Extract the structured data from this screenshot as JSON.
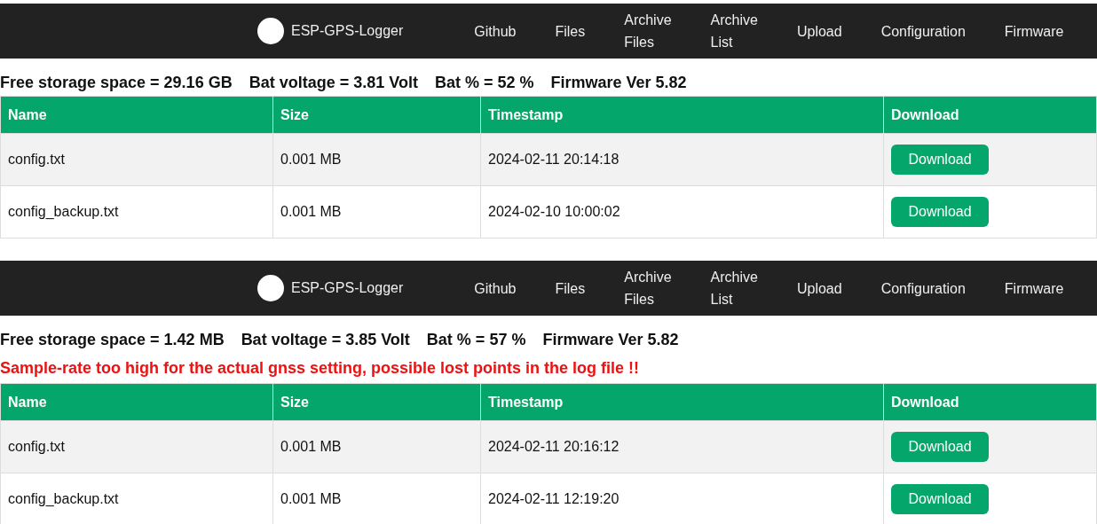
{
  "panels": [
    {
      "nav": {
        "brand": "ESP-GPS-Logger",
        "links": [
          "Github",
          "Files",
          "Archive Files",
          "Archive List",
          "Upload",
          "Configuration",
          "Firmware"
        ]
      },
      "status": [
        "Free storage space = 29.16 GB",
        "Bat voltage = 3.81 Volt",
        "Bat % = 52 %",
        "Firmware Ver 5.82"
      ],
      "table": {
        "columns": [
          "Name",
          "Size",
          "Timestamp",
          "Download"
        ],
        "rows": [
          {
            "cells": [
              "config.txt",
              "0.001 MB",
              "2024-02-11 20:14:18"
            ],
            "button": "Download"
          },
          {
            "cells": [
              "config_backup.txt",
              "0.001 MB",
              "2024-02-10 10:00:02"
            ],
            "button": "Download"
          }
        ]
      }
    },
    {
      "nav": {
        "brand": "ESP-GPS-Logger",
        "links": [
          "Github",
          "Files",
          "Archive Files",
          "Archive List",
          "Upload",
          "Configuration",
          "Firmware"
        ]
      },
      "status": [
        "Free storage space = 1.42 MB",
        "Bat voltage = 3.85 Volt",
        "Bat % = 57 %",
        "Firmware Ver 5.82"
      ],
      "warning": "Sample-rate too high for the actual gnss setting, possible lost points in the log file !!",
      "table": {
        "columns": [
          "Name",
          "Size",
          "Timestamp",
          "Download"
        ],
        "rows": [
          {
            "cells": [
              "config.txt",
              "0.001 MB",
              "2024-02-11 20:16:12"
            ],
            "button": "Download"
          },
          {
            "cells": [
              "config_backup.txt",
              "0.001 MB",
              "2024-02-11 12:19:20"
            ],
            "button": "Download"
          }
        ]
      }
    }
  ]
}
